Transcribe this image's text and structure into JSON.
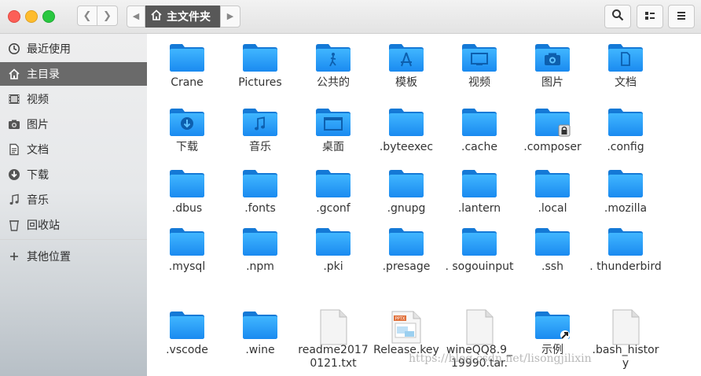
{
  "titlebar": {
    "breadcrumb_home": "主文件夹"
  },
  "sidebar": {
    "items": [
      {
        "label": "最近使用",
        "icon": "recent-icon"
      },
      {
        "label": "主目录",
        "icon": "home-icon",
        "active": true
      },
      {
        "label": "视频",
        "icon": "video-icon"
      },
      {
        "label": "图片",
        "icon": "camera-icon"
      },
      {
        "label": "文档",
        "icon": "document-icon"
      },
      {
        "label": "下载",
        "icon": "download-icon"
      },
      {
        "label": "音乐",
        "icon": "music-icon"
      },
      {
        "label": "回收站",
        "icon": "trash-icon"
      },
      {
        "label": "其他位置",
        "icon": "plus-icon"
      }
    ]
  },
  "files": {
    "items": [
      {
        "label": "Crane",
        "type": "folder"
      },
      {
        "label": "Pictures",
        "type": "folder"
      },
      {
        "label": "公共的",
        "type": "folder",
        "emblem": "person-icon"
      },
      {
        "label": "模板",
        "type": "folder",
        "emblem": "template-icon"
      },
      {
        "label": "视频",
        "type": "folder",
        "emblem": "video-icon"
      },
      {
        "label": "图片",
        "type": "folder",
        "emblem": "camera-icon"
      },
      {
        "label": "文档",
        "type": "folder",
        "emblem": "document-icon"
      },
      {
        "label": "下载",
        "type": "folder",
        "emblem": "download-icon"
      },
      {
        "label": "音乐",
        "type": "folder",
        "emblem": "music-icon"
      },
      {
        "label": "桌面",
        "type": "folder",
        "emblem": "desktop-icon"
      },
      {
        "label": ".byteexec",
        "type": "folder"
      },
      {
        "label": ".cache",
        "type": "folder"
      },
      {
        "label": ".composer",
        "type": "folder",
        "emblem": "lock-icon"
      },
      {
        "label": ".config",
        "type": "folder"
      },
      {
        "label": ".dbus",
        "type": "folder"
      },
      {
        "label": ".fonts",
        "type": "folder"
      },
      {
        "label": ".gconf",
        "type": "folder"
      },
      {
        "label": ".gnupg",
        "type": "folder"
      },
      {
        "label": ".lantern",
        "type": "folder"
      },
      {
        "label": ".local",
        "type": "folder"
      },
      {
        "label": ".mozilla",
        "type": "folder"
      },
      {
        "label": ".mysql",
        "type": "folder"
      },
      {
        "label": ".npm",
        "type": "folder"
      },
      {
        "label": ".pki",
        "type": "folder"
      },
      {
        "label": ".presage",
        "type": "folder"
      },
      {
        "label": ". sogouinput",
        "type": "folder"
      },
      {
        "label": ".ssh",
        "type": "folder"
      },
      {
        "label": ". thunderbird",
        "type": "folder"
      },
      {
        "label": ".vscode",
        "type": "folder"
      },
      {
        "label": ".wine",
        "type": "folder"
      },
      {
        "label": "readme20170121.txt",
        "type": "text"
      },
      {
        "label": "Release.key",
        "type": "pptx"
      },
      {
        "label": "wineQQ8.9_19990.tar.",
        "type": "text"
      },
      {
        "label": "示例",
        "type": "folder",
        "emblem": "link-icon"
      },
      {
        "label": ".bash_history",
        "type": "text"
      }
    ]
  },
  "watermark": "https://blog.csdn.net/lisongjilixin",
  "colors": {
    "folder_top": "#3fb3ff",
    "folder_bottom": "#1e8ef0",
    "sidebar_active": "#6a6a6a"
  }
}
